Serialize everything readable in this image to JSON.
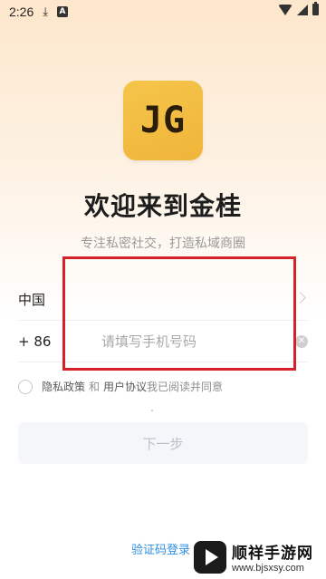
{
  "status_bar": {
    "time": "2:26",
    "icons": [
      "download-icon",
      "a-app-icon",
      "wifi-icon",
      "signal-icon",
      "battery-icon"
    ]
  },
  "logo": {
    "text": "JG",
    "color": "#f2bd45"
  },
  "title": "欢迎来到金桂",
  "subtitle": "专注私密社交，打造私域商圈",
  "country": {
    "label": "中国"
  },
  "phone": {
    "prefix": "+ 86",
    "placeholder": "请填写手机号码",
    "value": ""
  },
  "agreement": {
    "privacy": "隐私政策",
    "and": "和",
    "user_agreement": "用户协议",
    "consent": "我已阅读并同意"
  },
  "next_button": "下一步",
  "code_login": "验证码登录",
  "watermark": {
    "name": "顺祥手游网",
    "url": "www.bjsxsy.com"
  },
  "colors": {
    "accent_link": "#2f8ee0",
    "highlight": "#d8222a",
    "logo_bg": "#f2bd45",
    "button_bg": "#f4f6f9"
  }
}
